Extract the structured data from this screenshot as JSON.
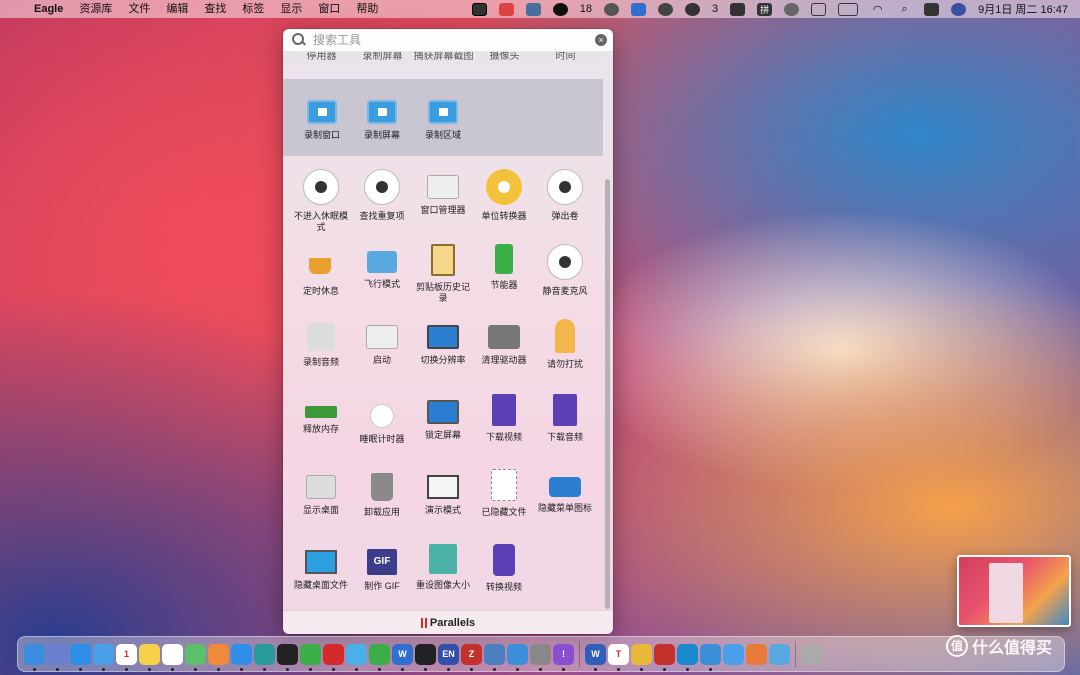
{
  "menubar": {
    "apple_icon": "apple-icon",
    "app_name": "Eagle",
    "menus": [
      "资源库",
      "文件",
      "编辑",
      "查找",
      "标签",
      "显示",
      "窗口",
      "帮助"
    ],
    "status": {
      "qq_badge": "18",
      "wechat_badge": "3",
      "input_method": "拼",
      "clock": "9月1日 周二  16:47"
    }
  },
  "panel": {
    "search_placeholder": "搜索工具",
    "cut_row": [
      "停用器",
      "录制屏幕",
      "捕获屏幕截图",
      "摄像头",
      "时间"
    ],
    "top_items": [
      {
        "label": "录制窗口",
        "icon": "record-window-icon"
      },
      {
        "label": "录制屏幕",
        "icon": "record-screen-icon"
      },
      {
        "label": "录制区域",
        "icon": "record-area-icon"
      }
    ],
    "grid": [
      {
        "label": "不进入休眠模式",
        "icon": "no-sleep-icon"
      },
      {
        "label": "查找重复项",
        "icon": "find-duplicates-icon"
      },
      {
        "label": "窗口管理器",
        "icon": "window-manager-icon"
      },
      {
        "label": "单位转换器",
        "icon": "unit-converter-icon"
      },
      {
        "label": "弹出卷",
        "icon": "eject-icon"
      },
      {
        "label": "定时休息",
        "icon": "break-timer-icon"
      },
      {
        "label": "飞行模式",
        "icon": "airplane-icon"
      },
      {
        "label": "剪贴板历史记录",
        "icon": "clipboard-icon"
      },
      {
        "label": "节能器",
        "icon": "battery-icon"
      },
      {
        "label": "静音麦克风",
        "icon": "mute-mic-icon"
      },
      {
        "label": "录制音频",
        "icon": "record-audio-icon"
      },
      {
        "label": "启动",
        "icon": "launch-icon"
      },
      {
        "label": "切换分辨率",
        "icon": "resolution-icon"
      },
      {
        "label": "清理驱动器",
        "icon": "clean-drive-icon"
      },
      {
        "label": "请勿打扰",
        "icon": "do-not-disturb-icon"
      },
      {
        "label": "释放内存",
        "icon": "free-memory-icon"
      },
      {
        "label": "睡眠计时器",
        "icon": "sleep-timer-icon"
      },
      {
        "label": "锁定屏幕",
        "icon": "lock-screen-icon"
      },
      {
        "label": "下载视频",
        "icon": "download-video-icon"
      },
      {
        "label": "下载音频",
        "icon": "download-audio-icon"
      },
      {
        "label": "显示桌面",
        "icon": "show-desktop-icon"
      },
      {
        "label": "卸载应用",
        "icon": "uninstall-icon"
      },
      {
        "label": "演示模式",
        "icon": "presentation-icon"
      },
      {
        "label": "已隐藏文件",
        "icon": "hidden-files-icon"
      },
      {
        "label": "隐藏菜单图标",
        "icon": "hide-menu-icons-icon"
      },
      {
        "label": "隐藏桌面文件",
        "icon": "hide-desktop-files-icon"
      },
      {
        "label": "制作 GIF",
        "icon": "make-gif-icon"
      },
      {
        "label": "重设图像大小",
        "icon": "resize-image-icon"
      },
      {
        "label": "转换视频",
        "icon": "convert-video-icon"
      }
    ],
    "footer_brand": "Parallels",
    "gif_badge": "GIF"
  },
  "watermark": {
    "logo": "值",
    "text": "什么值得买"
  },
  "dock_apps": [
    {
      "name": "finder",
      "color": "#3b8de0",
      "label": ""
    },
    {
      "name": "launchpad",
      "color": "#6a7fd0",
      "label": ""
    },
    {
      "name": "safari",
      "color": "#2f8fe8",
      "label": ""
    },
    {
      "name": "mail",
      "color": "#4aa0e8",
      "label": ""
    },
    {
      "name": "calendar",
      "color": "#ffffff",
      "label": "1"
    },
    {
      "name": "notes",
      "color": "#f5d04a",
      "label": ""
    },
    {
      "name": "reminders",
      "color": "#ffffff",
      "label": ""
    },
    {
      "name": "maps",
      "color": "#5cc06a",
      "label": ""
    },
    {
      "name": "photos",
      "color": "#f08a3a",
      "label": ""
    },
    {
      "name": "app-store",
      "color": "#2f8fe8",
      "label": ""
    },
    {
      "name": "edge",
      "color": "#2a9a9a",
      "label": ""
    },
    {
      "name": "qq",
      "color": "#222222",
      "label": ""
    },
    {
      "name": "wechat",
      "color": "#3cb048",
      "label": ""
    },
    {
      "name": "netease",
      "color": "#d42a2a",
      "label": ""
    },
    {
      "name": "mail-2",
      "color": "#4ab0e8",
      "label": ""
    },
    {
      "name": "evernote",
      "color": "#3cae48",
      "label": ""
    },
    {
      "name": "wps",
      "color": "#2f6fd0",
      "label": "W"
    },
    {
      "name": "figma",
      "color": "#222222",
      "label": ""
    },
    {
      "name": "eudic",
      "color": "#2f4fa8",
      "label": "EN"
    },
    {
      "name": "zotero",
      "color": "#c4302a",
      "label": "Z"
    },
    {
      "name": "network",
      "color": "#4a7fc0",
      "label": ""
    },
    {
      "name": "bird",
      "color": "#3a8fd8",
      "label": ""
    },
    {
      "name": "settings",
      "color": "#888888",
      "label": ""
    },
    {
      "name": "feedback",
      "color": "#8a4fd0",
      "label": "!"
    },
    {
      "name": "word",
      "color": "#2f5fb8",
      "label": "W"
    },
    {
      "name": "typora",
      "color": "#ffffff",
      "label": "T"
    },
    {
      "name": "chrome",
      "color": "#e8b83a",
      "label": ""
    },
    {
      "name": "acrobat",
      "color": "#c4302a",
      "label": ""
    },
    {
      "name": "edge-2",
      "color": "#1a8acc",
      "label": ""
    },
    {
      "name": "monitor",
      "color": "#3a8fd8",
      "label": ""
    },
    {
      "name": "folder-1",
      "color": "#4aa0e8",
      "label": ""
    },
    {
      "name": "folder-2",
      "color": "#e87a3a",
      "label": ""
    },
    {
      "name": "folder-3",
      "color": "#5aa8e0",
      "label": ""
    },
    {
      "name": "trash",
      "color": "#aaaaaa",
      "label": ""
    }
  ]
}
